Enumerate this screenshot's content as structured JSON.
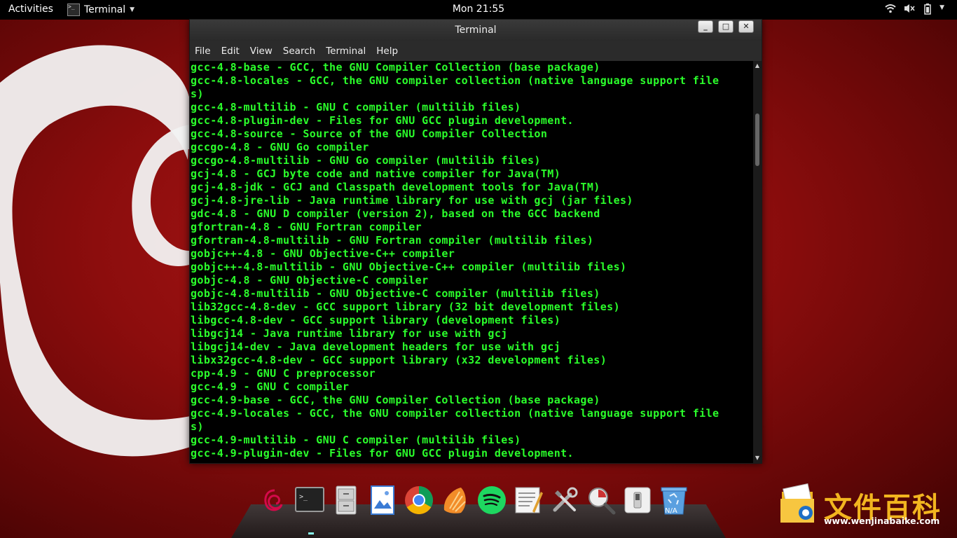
{
  "topbar": {
    "activities": "Activities",
    "app_name": "Terminal",
    "clock": "Mon 21:55"
  },
  "window": {
    "title": "Terminal",
    "menu": [
      "File",
      "Edit",
      "View",
      "Search",
      "Terminal",
      "Help"
    ],
    "lines": [
      "gcc-4.8-base - GCC, the GNU Compiler Collection (base package)",
      "gcc-4.8-locales - GCC, the GNU compiler collection (native language support file",
      "s)",
      "gcc-4.8-multilib - GNU C compiler (multilib files)",
      "gcc-4.8-plugin-dev - Files for GNU GCC plugin development.",
      "gcc-4.8-source - Source of the GNU Compiler Collection",
      "gccgo-4.8 - GNU Go compiler",
      "gccgo-4.8-multilib - GNU Go compiler (multilib files)",
      "gcj-4.8 - GCJ byte code and native compiler for Java(TM)",
      "gcj-4.8-jdk - GCJ and Classpath development tools for Java(TM)",
      "gcj-4.8-jre-lib - Java runtime library for use with gcj (jar files)",
      "gdc-4.8 - GNU D compiler (version 2), based on the GCC backend",
      "gfortran-4.8 - GNU Fortran compiler",
      "gfortran-4.8-multilib - GNU Fortran compiler (multilib files)",
      "gobjc++-4.8 - GNU Objective-C++ compiler",
      "gobjc++-4.8-multilib - GNU Objective-C++ compiler (multilib files)",
      "gobjc-4.8 - GNU Objective-C compiler",
      "gobjc-4.8-multilib - GNU Objective-C compiler (multilib files)",
      "lib32gcc-4.8-dev - GCC support library (32 bit development files)",
      "libgcc-4.8-dev - GCC support library (development files)",
      "libgcj14 - Java runtime library for use with gcj",
      "libgcj14-dev - Java development headers for use with gcj",
      "libx32gcc-4.8-dev - GCC support library (x32 development files)",
      "cpp-4.9 - GNU C preprocessor",
      "gcc-4.9 - GNU C compiler",
      "gcc-4.9-base - GCC, the GNU Compiler Collection (base package)",
      "gcc-4.9-locales - GCC, the GNU compiler collection (native language support file",
      "s)",
      "gcc-4.9-multilib - GNU C compiler (multilib files)",
      "gcc-4.9-plugin-dev - Files for GNU GCC plugin development."
    ]
  },
  "dock": {
    "recycle_label": "N/A"
  },
  "watermark": {
    "title": "文件百科",
    "url": "www.wenjinabaike.com"
  },
  "colors": {
    "terminal_text": "#2bff2b",
    "watermark": "#f2b51f"
  }
}
